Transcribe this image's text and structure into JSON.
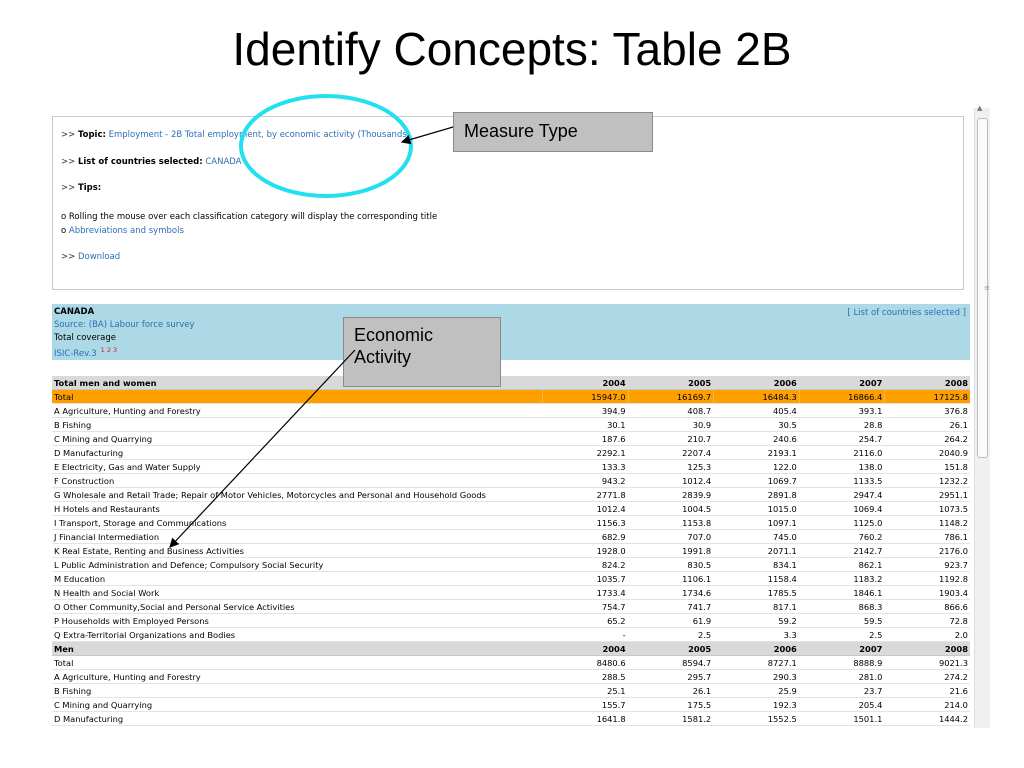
{
  "slide": {
    "title": "Identify Concepts: Table 2B"
  },
  "topic_box": {
    "arrows": ">>",
    "topic_label": "Topic:",
    "topic_value": "Employment - 2B Total employment, by economic activity (Thousands)",
    "countries_label": "List of countries selected:",
    "countries_value": "CANADA",
    "tips_label": "Tips:",
    "tip_bullet": "o",
    "tip_1": "Rolling the mouse over each classification category will display the corresponding title",
    "tip_2": "Abbreviations and symbols",
    "download": "Download"
  },
  "country_panel": {
    "name": "CANADA",
    "source": "Source: (BA) Labour force survey",
    "coverage": "Total coverage",
    "classification": "ISIC-Rev.3",
    "notes": "1 2 3",
    "list_link": "[ List of countries selected ]"
  },
  "annotations": {
    "measure_type": "Measure Type",
    "economic_activity_line1": "Economic",
    "economic_activity_line2": "Activity"
  },
  "table": {
    "sections": [
      {
        "header": "Total men and women",
        "years": [
          "2004",
          "2005",
          "2006",
          "2007",
          "2008"
        ],
        "rows": [
          {
            "name": "Total",
            "values": [
              "15947.0",
              "16169.7",
              "16484.3",
              "16866.4",
              "17125.8"
            ],
            "highlight": true
          },
          {
            "name": "A Agriculture, Hunting and Forestry",
            "values": [
              "394.9",
              "408.7",
              "405.4",
              "393.1",
              "376.8"
            ]
          },
          {
            "name": "B Fishing",
            "values": [
              "30.1",
              "30.9",
              "30.5",
              "28.8",
              "26.1"
            ]
          },
          {
            "name": "C Mining and Quarrying",
            "values": [
              "187.6",
              "210.7",
              "240.6",
              "254.7",
              "264.2"
            ]
          },
          {
            "name": "D Manufacturing",
            "values": [
              "2292.1",
              "2207.4",
              "2193.1",
              "2116.0",
              "2040.9"
            ]
          },
          {
            "name": "E Electricity, Gas and Water Supply",
            "values": [
              "133.3",
              "125.3",
              "122.0",
              "138.0",
              "151.8"
            ]
          },
          {
            "name": "F Construction",
            "values": [
              "943.2",
              "1012.4",
              "1069.7",
              "1133.5",
              "1232.2"
            ]
          },
          {
            "name": "G Wholesale and Retail Trade; Repair of Motor Vehicles, Motorcycles and Personal and Household Goods",
            "values": [
              "2771.8",
              "2839.9",
              "2891.8",
              "2947.4",
              "2951.1"
            ]
          },
          {
            "name": "H Hotels and Restaurants",
            "values": [
              "1012.4",
              "1004.5",
              "1015.0",
              "1069.4",
              "1073.5"
            ]
          },
          {
            "name": "I Transport, Storage and Communications",
            "values": [
              "1156.3",
              "1153.8",
              "1097.1",
              "1125.0",
              "1148.2"
            ]
          },
          {
            "name": "J Financial Intermediation",
            "values": [
              "682.9",
              "707.0",
              "745.0",
              "760.2",
              "786.1"
            ]
          },
          {
            "name": "K Real Estate, Renting and Business Activities",
            "values": [
              "1928.0",
              "1991.8",
              "2071.1",
              "2142.7",
              "2176.0"
            ]
          },
          {
            "name": "L Public Administration and Defence; Compulsory Social Security",
            "values": [
              "824.2",
              "830.5",
              "834.1",
              "862.1",
              "923.7"
            ]
          },
          {
            "name": "M Education",
            "values": [
              "1035.7",
              "1106.1",
              "1158.4",
              "1183.2",
              "1192.8"
            ]
          },
          {
            "name": "N Health and Social Work",
            "values": [
              "1733.4",
              "1734.6",
              "1785.5",
              "1846.1",
              "1903.4"
            ]
          },
          {
            "name": "O Other Community,Social and Personal Service Activities",
            "values": [
              "754.7",
              "741.7",
              "817.1",
              "868.3",
              "866.6"
            ]
          },
          {
            "name": "P Households with Employed Persons",
            "values": [
              "65.2",
              "61.9",
              "59.2",
              "59.5",
              "72.8"
            ]
          },
          {
            "name": "Q Extra-Territorial Organizations and Bodies",
            "values": [
              "-",
              "2.5",
              "3.3",
              "2.5",
              "2.0"
            ]
          }
        ]
      },
      {
        "header": "Men",
        "years": [
          "2004",
          "2005",
          "2006",
          "2007",
          "2008"
        ],
        "rows": [
          {
            "name": "Total",
            "values": [
              "8480.6",
              "8594.7",
              "8727.1",
              "8888.9",
              "9021.3"
            ]
          },
          {
            "name": "A Agriculture, Hunting and Forestry",
            "values": [
              "288.5",
              "295.7",
              "290.3",
              "281.0",
              "274.2"
            ]
          },
          {
            "name": "B Fishing",
            "values": [
              "25.1",
              "26.1",
              "25.9",
              "23.7",
              "21.6"
            ]
          },
          {
            "name": "C Mining and Quarrying",
            "values": [
              "155.7",
              "175.5",
              "192.3",
              "205.4",
              "214.0"
            ]
          },
          {
            "name": "D Manufacturing",
            "values": [
              "1641.8",
              "1581.2",
              "1552.5",
              "1501.1",
              "1444.2"
            ]
          }
        ]
      }
    ]
  }
}
